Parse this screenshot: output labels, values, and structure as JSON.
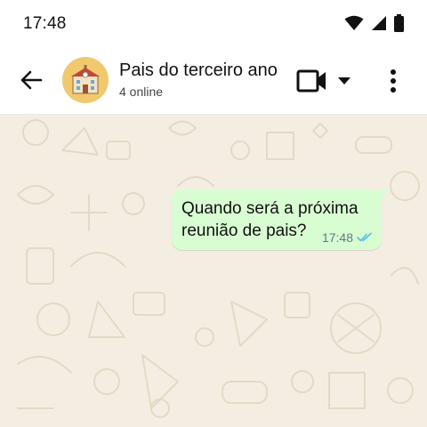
{
  "status_bar": {
    "time": "17:48",
    "icons": [
      "wifi-icon",
      "signal-icon",
      "battery-icon"
    ]
  },
  "header": {
    "title": "Pais do terceiro ano",
    "subtitle": "4 online",
    "avatar_icon": "school-icon",
    "icons": [
      "back-arrow-icon",
      "video-call-icon",
      "dropdown-arrow-icon",
      "more-vert-icon"
    ]
  },
  "conversation": {
    "messages": [
      {
        "direction": "outgoing",
        "text": "Quando será a próxima reunião de pais?",
        "time": "17:48",
        "status": "read"
      }
    ]
  },
  "colors": {
    "outgoing_bubble": "#d9fdd3",
    "chat_background": "#f4eee2",
    "read_ticks": "#53bdeb",
    "avatar_background": "#f0c96f"
  }
}
